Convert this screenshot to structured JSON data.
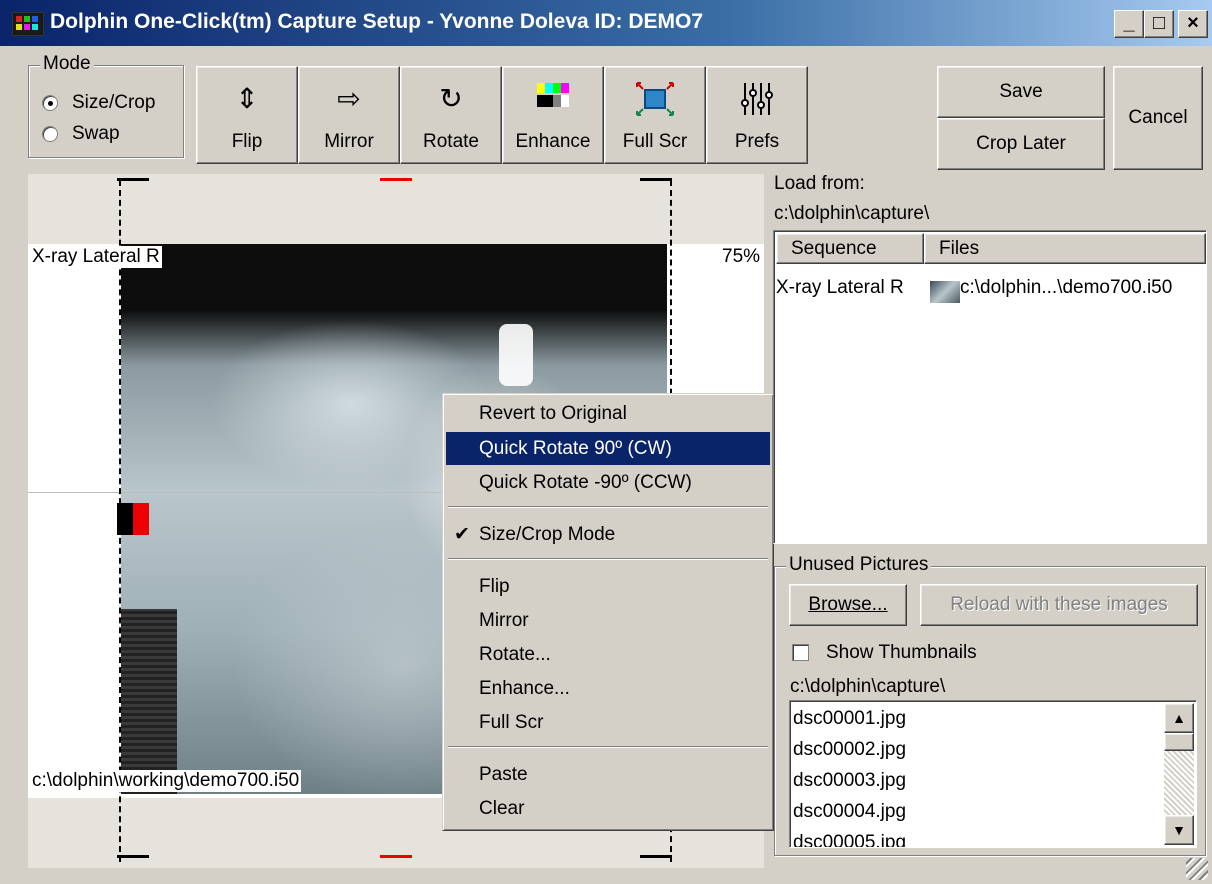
{
  "window": {
    "title": "Dolphin One-Click(tm) Capture Setup - Yvonne Doleva  ID: DEMO7",
    "minimize": "_",
    "maximize": "□",
    "close": "×"
  },
  "mode": {
    "label": "Mode",
    "options": [
      "Size/Crop",
      "Swap"
    ],
    "selected": "Size/Crop"
  },
  "toolbar": {
    "flip": "Flip",
    "mirror": "Mirror",
    "rotate": "Rotate",
    "enhance": "Enhance",
    "fullscr": "Full Scr",
    "prefs": "Prefs"
  },
  "actions": {
    "save": "Save",
    "crop_later": "Crop Later",
    "cancel": "Cancel"
  },
  "image": {
    "caption": "X-ray Lateral R",
    "zoom": "75%",
    "path": "c:\\dolphin\\working\\demo700.i50"
  },
  "context_menu": {
    "items": [
      {
        "label": "Revert to Original"
      },
      {
        "label": "Quick Rotate 90º (CW)"
      },
      {
        "label": "Quick Rotate  -90º (CCW)"
      },
      {
        "label": "Size/Crop Mode"
      },
      {
        "label": "Flip"
      },
      {
        "label": "Mirror"
      },
      {
        "label": "Rotate..."
      },
      {
        "label": "Enhance..."
      },
      {
        "label": "Full Scr"
      },
      {
        "label": "Paste"
      },
      {
        "label": "Clear"
      }
    ],
    "highlighted": "Quick Rotate 90º (CW)",
    "checked": "Size/Crop Mode"
  },
  "load": {
    "label": "Load from:",
    "path": "c:\\dolphin\\capture\\",
    "columns": [
      "Sequence",
      "Files"
    ],
    "rows": [
      {
        "sequence": "X-ray Lateral R",
        "file": "c:\\dolphin...\\demo700.i50"
      }
    ]
  },
  "unused": {
    "label": "Unused Pictures",
    "browse": "Browse...",
    "reload": "Reload with these images",
    "show_thumbnails": "Show Thumbnails",
    "path": "c:\\dolphin\\capture\\",
    "files": [
      "dsc00001.jpg",
      "dsc00002.jpg",
      "dsc00003.jpg",
      "dsc00004.jpg",
      "dsc00005.jpg"
    ]
  }
}
